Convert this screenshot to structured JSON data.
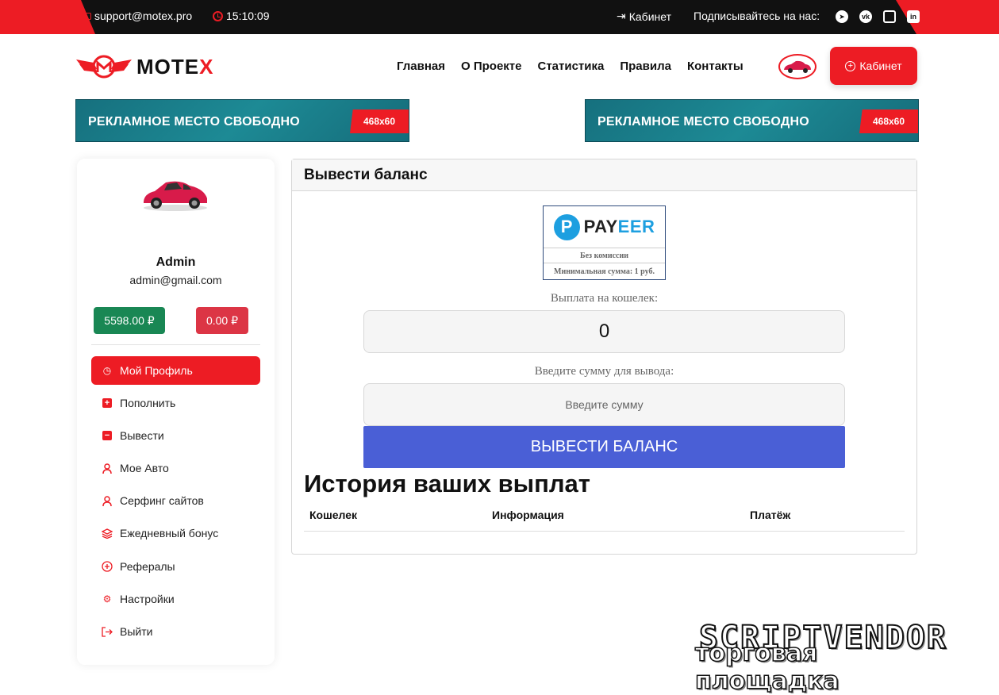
{
  "topbar": {
    "email": "support@motex.pro",
    "time": "15:10:09",
    "cabinet": "Кабинет",
    "subscribe": "Подписывайтесь на нас:"
  },
  "header": {
    "logo": "MOTEX",
    "nav": [
      "Главная",
      "О Проекте",
      "Статистика",
      "Правила",
      "Контакты"
    ],
    "cabinet_button": "Кабинет"
  },
  "banners": [
    {
      "text": "РЕКЛАМНОЕ  МЕСТО СВОБОДНО",
      "size": "468x60"
    },
    {
      "text": "РЕКЛАМНОЕ  МЕСТО СВОБОДНО",
      "size": "468x60"
    }
  ],
  "sidebar": {
    "name": "Admin",
    "email": "admin@gmail.com",
    "balance_main": "5598.00 ₽",
    "balance_out": "0.00 ₽",
    "menu": [
      {
        "label": "Мой Профиль",
        "icon": "dashboard-icon"
      },
      {
        "label": "Пополнить",
        "icon": "plus-square-icon"
      },
      {
        "label": "Вывести",
        "icon": "minus-square-icon"
      },
      {
        "label": "Мое Авто",
        "icon": "user-icon"
      },
      {
        "label": "Серфинг сайтов",
        "icon": "user-icon"
      },
      {
        "label": "Ежедневный бонус",
        "icon": "layers-icon"
      },
      {
        "label": "Рефералы",
        "icon": "plus-circle-icon"
      },
      {
        "label": "Настройки",
        "icon": "gear-icon"
      },
      {
        "label": "Выйти",
        "icon": "logout-icon"
      }
    ]
  },
  "main": {
    "title": "Вывести баланс",
    "payeer": {
      "brand_left": "PAY",
      "brand_right": "EER",
      "commission": "Без комиссии",
      "min_sum": "Минимальная сумма: 1 руб."
    },
    "wallet_label": "Выплата на кошелек:",
    "wallet_value": "0",
    "amount_label": "Введите сумму для вывода:",
    "amount_placeholder": "Введите сумму",
    "withdraw_button": "ВЫВЕСТИ БАЛАНС",
    "history_title": "История ваших выплат",
    "history_columns": [
      "Кошелек",
      "Информация",
      "Платёж"
    ]
  },
  "watermark": {
    "line1": "SCRIPTVENDOR",
    "line2": "торговая площадка"
  },
  "colors": {
    "accent": "#ed1c24",
    "topbar": "#111111",
    "success": "#198754",
    "danger": "#dc3545",
    "primary_button": "#4a5fd6",
    "payeer_blue": "#1d9fe0"
  }
}
